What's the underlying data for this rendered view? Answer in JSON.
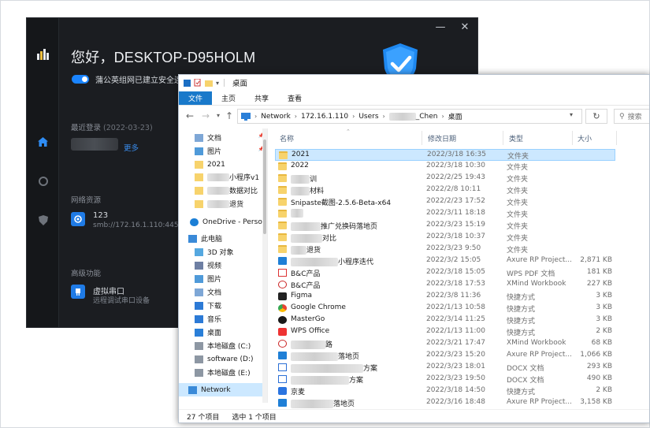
{
  "colors": {
    "accent": "#1a84ff",
    "dark_bg": "#1b1d21",
    "explorer_file_tab": "#1979ca",
    "selection": "#cce8ff"
  },
  "dark_app": {
    "window_controls": {
      "minimize": "—",
      "close": "✕"
    },
    "sidebar_icons": [
      "app-logo-icon",
      "home-icon",
      "network-icon",
      "shield-icon"
    ],
    "title": "您好，DESKTOP-D95HOLM",
    "status_text": "蒲公英组网已建立安全连",
    "last_login": {
      "label": "最近登录",
      "date": "(2022-03-23)",
      "more_link": "更多"
    },
    "network_resources": {
      "label": "网络资源",
      "name": "123",
      "path": "smb://172.16.1.110:445"
    },
    "advanced": {
      "label": "高级功能",
      "name": "虚拟串口",
      "desc": "远程调试串口设备"
    }
  },
  "explorer": {
    "window_title": "桌面",
    "ribbon_tabs": [
      "文件",
      "主页",
      "共享",
      "查看"
    ],
    "address": {
      "crumbs": [
        "Network",
        "172.16.1.110",
        "Users",
        "_Chen",
        "桌面"
      ]
    },
    "search_placeholder": "搜索",
    "nav_items": [
      {
        "label": "文档",
        "icon": "document-icon",
        "pinned": true
      },
      {
        "label": "图片",
        "icon": "pictures-icon",
        "pinned": true
      },
      {
        "label": "2021",
        "icon": "folder-icon",
        "pinned": false
      },
      {
        "label": "小程序v1",
        "icon": "folder-icon",
        "pinned": false
      },
      {
        "label": "数据对比",
        "icon": "folder-icon",
        "pinned": false
      },
      {
        "label": "退货",
        "icon": "folder-icon",
        "pinned": false
      },
      {
        "label": "OneDrive - Perso",
        "icon": "onedrive-icon",
        "pinned": false
      },
      {
        "label": "此电脑",
        "icon": "computer-icon",
        "pinned": false
      },
      {
        "label": "3D 对象",
        "icon": "objects-3d-icon",
        "pinned": false
      },
      {
        "label": "视频",
        "icon": "video-icon",
        "pinned": false
      },
      {
        "label": "图片",
        "icon": "pictures-icon",
        "pinned": false
      },
      {
        "label": "文档",
        "icon": "document-icon",
        "pinned": false
      },
      {
        "label": "下载",
        "icon": "download-icon",
        "pinned": false
      },
      {
        "label": "音乐",
        "icon": "music-icon",
        "pinned": false
      },
      {
        "label": "桌面",
        "icon": "desktop-icon",
        "pinned": false
      },
      {
        "label": "本地磁盘 (C:)",
        "icon": "drive-icon",
        "pinned": false
      },
      {
        "label": "software (D:)",
        "icon": "drive-icon",
        "pinned": false
      },
      {
        "label": "本地磁盘 (E:)",
        "icon": "drive-icon",
        "pinned": false
      },
      {
        "label": "Network",
        "icon": "network-icon",
        "pinned": false
      }
    ],
    "columns": {
      "name": "名称",
      "modified": "修改日期",
      "type": "类型",
      "size": "大小"
    },
    "files": [
      {
        "name": "2021",
        "date": "2022/3/18 16:35",
        "type": "文件夹",
        "size": "",
        "icon": "folder"
      },
      {
        "name": "2022",
        "date": "2022/3/18 10:30",
        "type": "文件夹",
        "size": "",
        "icon": "folder"
      },
      {
        "name": "训",
        "date": "2022/2/25 19:43",
        "type": "文件夹",
        "size": "",
        "icon": "folder"
      },
      {
        "name": "材料",
        "date": "2022/2/8 10:11",
        "type": "文件夹",
        "size": "",
        "icon": "folder"
      },
      {
        "name": "Snipaste截图-2.5.6-Beta-x64",
        "date": "2022/2/23 17:52",
        "type": "文件夹",
        "size": "",
        "icon": "folder"
      },
      {
        "name": "",
        "date": "2022/3/11 18:18",
        "type": "文件夹",
        "size": "",
        "icon": "folder"
      },
      {
        "name": "推广兑换码落地页",
        "date": "2022/3/23 15:19",
        "type": "文件夹",
        "size": "",
        "icon": "folder"
      },
      {
        "name": "对比",
        "date": "2022/3/18 10:37",
        "type": "文件夹",
        "size": "",
        "icon": "folder"
      },
      {
        "name": "退货",
        "date": "2022/3/23 9:50",
        "type": "文件夹",
        "size": "",
        "icon": "folder"
      },
      {
        "name": "小程序迭代",
        "date": "2022/3/2 15:05",
        "type": "Axure RP Project...",
        "size": "2,871 KB",
        "icon": "axure"
      },
      {
        "name": "B&C产品",
        "date": "2022/3/18 15:05",
        "type": "WPS PDF 文档",
        "size": "181 KB",
        "icon": "pdf"
      },
      {
        "name": "B&C产品",
        "date": "2022/3/18 17:53",
        "type": "XMind Workbook",
        "size": "227 KB",
        "icon": "xmind"
      },
      {
        "name": "Figma",
        "date": "2022/3/8 11:36",
        "type": "快捷方式",
        "size": "3 KB",
        "icon": "figma"
      },
      {
        "name": "Google Chrome",
        "date": "2022/1/13 10:58",
        "type": "快捷方式",
        "size": "3 KB",
        "icon": "chrome"
      },
      {
        "name": "MasterGo",
        "date": "2022/3/14 11:25",
        "type": "快捷方式",
        "size": "3 KB",
        "icon": "mastergo"
      },
      {
        "name": "WPS Office",
        "date": "2022/1/13 11:00",
        "type": "快捷方式",
        "size": "2 KB",
        "icon": "wps"
      },
      {
        "name": "路",
        "date": "2022/3/21 17:47",
        "type": "XMind Workbook",
        "size": "68 KB",
        "icon": "xmind"
      },
      {
        "name": "落地页",
        "date": "2022/3/23 15:20",
        "type": "Axure RP Project...",
        "size": "1,066 KB",
        "icon": "axure"
      },
      {
        "name": "方案",
        "date": "2022/3/23 18:01",
        "type": "DOCX 文档",
        "size": "293 KB",
        "icon": "docx"
      },
      {
        "name": "方案",
        "date": "2022/3/23 19:50",
        "type": "DOCX 文档",
        "size": "490 KB",
        "icon": "docx"
      },
      {
        "name": "京麦",
        "date": "2022/3/18 14:50",
        "type": "快捷方式",
        "size": "2 KB",
        "icon": "jingmai"
      },
      {
        "name": "落地页",
        "date": "2022/3/16 18:48",
        "type": "Axure RP Project...",
        "size": "3,158 KB",
        "icon": "axure"
      }
    ],
    "status": {
      "count": "27 个项目",
      "selected": "选中 1 个项目"
    }
  }
}
